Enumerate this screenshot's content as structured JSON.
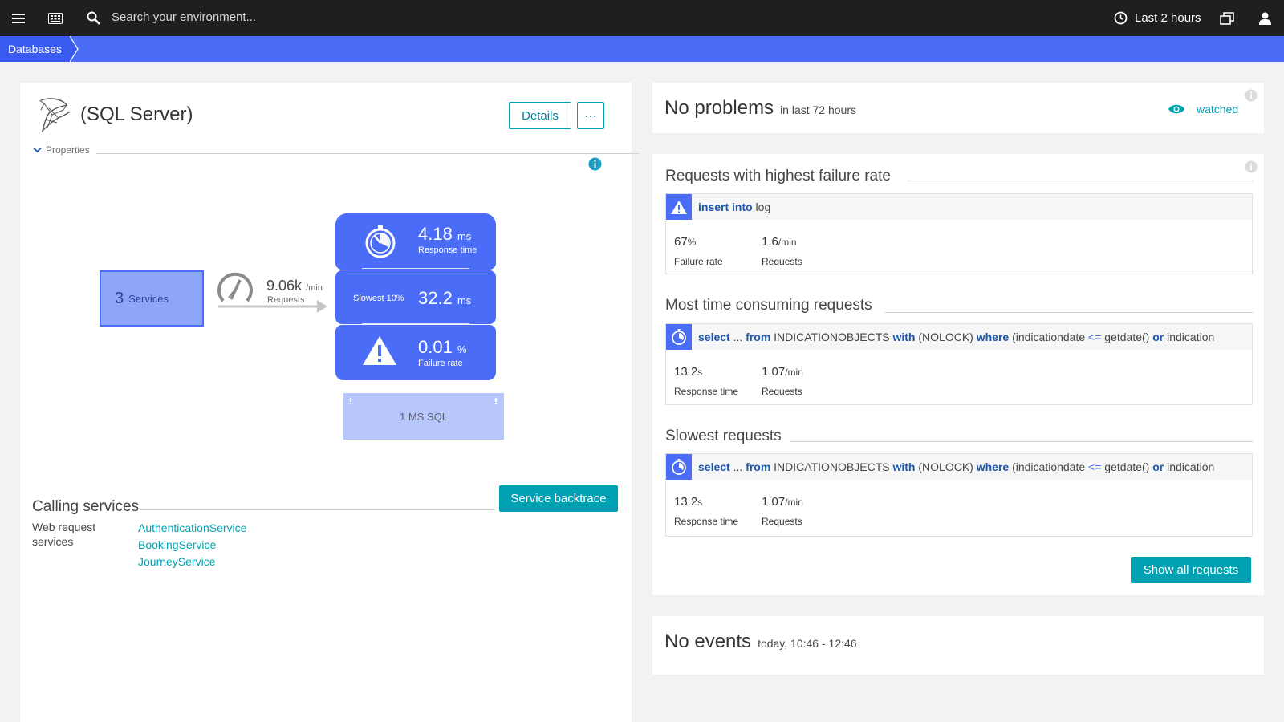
{
  "topbar": {
    "search_placeholder": "Search your environment...",
    "timeframe": "Last 2 hours"
  },
  "breadcrumb": {
    "items": [
      "Databases"
    ]
  },
  "entity": {
    "title": "(SQL Server)",
    "details_label": "Details",
    "more_label": "···",
    "properties_label": "Properties"
  },
  "flow": {
    "services_count": "3",
    "services_label": "Services",
    "requests_value": "9.06k",
    "requests_unit": "/min",
    "requests_label": "Requests",
    "response_time_value": "4.18",
    "response_time_unit": "ms",
    "response_time_label": "Response time",
    "slowest_label": "Slowest 10%",
    "slowest_value": "32.2",
    "slowest_unit": "ms",
    "failure_value": "0.01",
    "failure_unit": "%",
    "failure_label": "Failure rate",
    "db_label": "1 MS SQL"
  },
  "calling": {
    "title": "Calling services",
    "backtrace_label": "Service backtrace",
    "type_label": "Web request services",
    "services": [
      "AuthenticationService",
      "BookingService",
      "JourneyService"
    ]
  },
  "problems": {
    "title": "No problems",
    "subtitle": "in last 72 hours",
    "watched_label": "watched"
  },
  "requests_panel": {
    "failure_section": {
      "title": "Requests with highest failure rate",
      "query": [
        {
          "t": "insert into",
          "k": "kw"
        },
        {
          "t": " log",
          "k": ""
        }
      ],
      "stat1_value": "67",
      "stat1_unit": "%",
      "stat1_label": "Failure rate",
      "stat2_value": "1.6",
      "stat2_unit": "/min",
      "stat2_label": "Requests"
    },
    "time_section": {
      "title": "Most time consuming requests",
      "query": [
        {
          "t": "select",
          "k": "kw"
        },
        {
          "t": " ... ",
          "k": ""
        },
        {
          "t": "from",
          "k": "kw"
        },
        {
          "t": " INDICATIONOBJECTS ",
          "k": ""
        },
        {
          "t": "with",
          "k": "kw"
        },
        {
          "t": " (NOLOCK) ",
          "k": ""
        },
        {
          "t": "where",
          "k": "kw"
        },
        {
          "t": " (indicationdate ",
          "k": ""
        },
        {
          "t": "<=",
          "k": "op"
        },
        {
          "t": " getdate() ",
          "k": ""
        },
        {
          "t": "or",
          "k": "kw"
        },
        {
          "t": " indication",
          "k": ""
        }
      ],
      "stat1_value": "13.2",
      "stat1_unit": "s",
      "stat1_label": "Response time",
      "stat2_value": "1.07",
      "stat2_unit": "/min",
      "stat2_label": "Requests"
    },
    "slowest_section": {
      "title": "Slowest requests",
      "query": [
        {
          "t": "select",
          "k": "kw"
        },
        {
          "t": " ... ",
          "k": ""
        },
        {
          "t": "from",
          "k": "kw"
        },
        {
          "t": " INDICATIONOBJECTS ",
          "k": ""
        },
        {
          "t": "with",
          "k": "kw"
        },
        {
          "t": " (NOLOCK) ",
          "k": ""
        },
        {
          "t": "where",
          "k": "kw"
        },
        {
          "t": " (indicationdate ",
          "k": ""
        },
        {
          "t": "<=",
          "k": "op"
        },
        {
          "t": " getdate() ",
          "k": ""
        },
        {
          "t": "or",
          "k": "kw"
        },
        {
          "t": " indication",
          "k": ""
        }
      ],
      "stat1_value": "13.2",
      "stat1_unit": "s",
      "stat1_label": "Response time",
      "stat2_value": "1.07",
      "stat2_unit": "/min",
      "stat2_label": "Requests"
    },
    "show_all_label": "Show all requests"
  },
  "events": {
    "title": "No events",
    "subtitle": "today, 10:46 - 12:46"
  },
  "colors": {
    "topbar": "#1f1f1f",
    "accent_blue": "#4a6cf7",
    "teal": "#00a1b2",
    "keyword": "#1c57ae"
  }
}
